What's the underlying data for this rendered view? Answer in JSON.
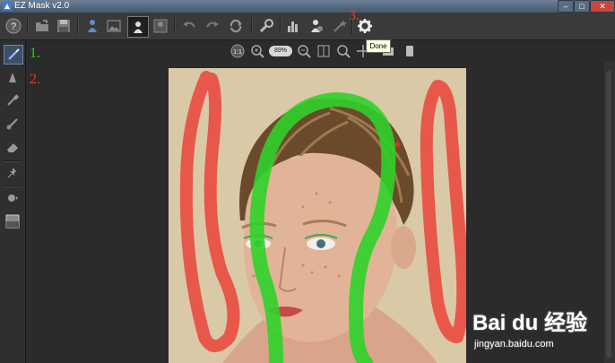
{
  "window": {
    "title": "EZ Mask v2.0"
  },
  "window_controls": {
    "minimize": "–",
    "maximize": "□",
    "close": "✕"
  },
  "toolbar": {
    "items": [
      {
        "icon": "help-icon"
      },
      {
        "icon": "open-icon"
      },
      {
        "icon": "save-icon"
      },
      {
        "icon": "person-icon"
      },
      {
        "icon": "image-icon"
      },
      {
        "icon": "mask-person-icon"
      },
      {
        "icon": "mask-image-icon"
      },
      {
        "icon": "undo-icon"
      },
      {
        "icon": "redo-icon"
      },
      {
        "icon": "refresh-icon"
      },
      {
        "icon": "wrench-icon"
      },
      {
        "icon": "histogram-icon"
      },
      {
        "icon": "person-gear-icon"
      },
      {
        "icon": "magic-wand-icon"
      },
      {
        "icon": "gear-icon"
      }
    ]
  },
  "zoombar": {
    "zoom_value": "89%"
  },
  "tooltip": {
    "text": "Done"
  },
  "annotations": {
    "one": "1.",
    "two": "2.",
    "three": "3."
  },
  "watermark": {
    "brand": "Bai du 经验",
    "url": "jingyan.baidu.com"
  },
  "colors": {
    "keep_stroke": "#2fd12a",
    "drop_stroke": "#e8584a",
    "accent": "#e23b2e"
  }
}
